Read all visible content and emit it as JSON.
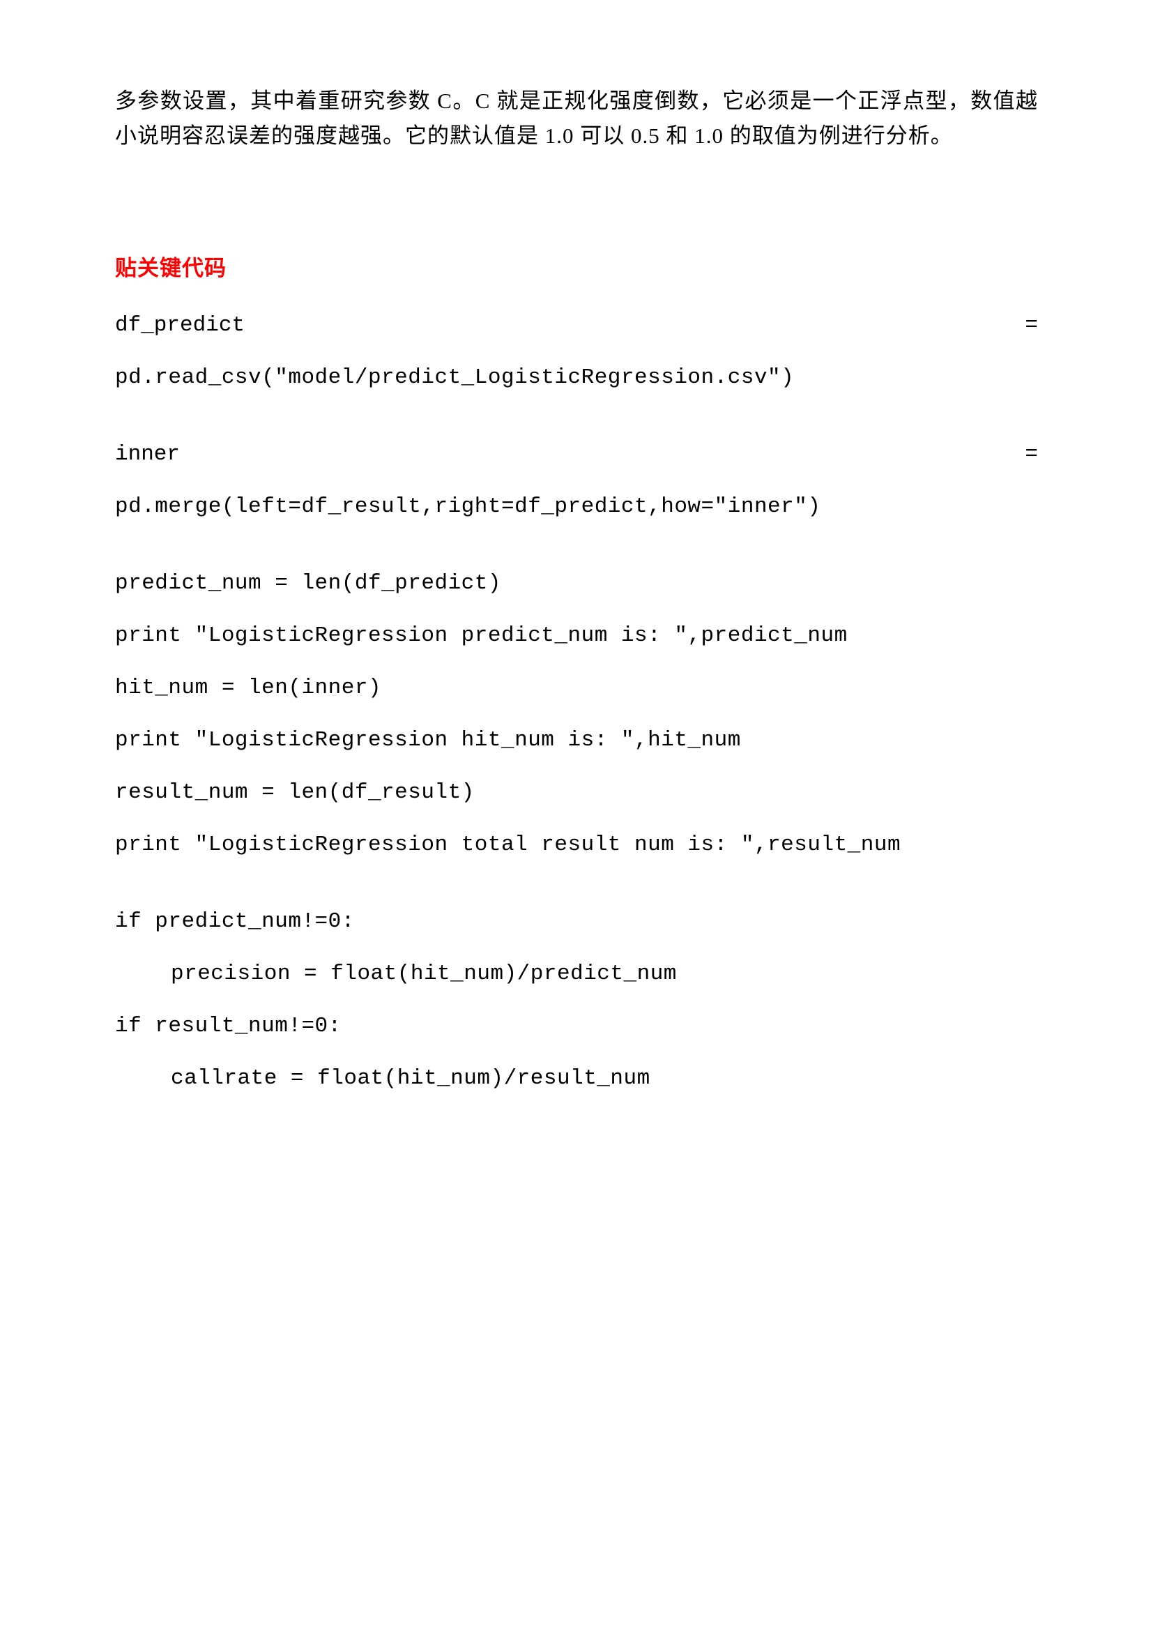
{
  "intro": "多参数设置，其中着重研究参数 C。C 就是正规化强度倒数，它必须是一个正浮点型，数值越小说明容忍误差的强度越强。它的默认值是 1.0 可以 0.5 和 1.0 的取值为例进行分析。",
  "heading": "贴关键代码",
  "code": {
    "line01_left": "df_predict",
    "line01_right": "=",
    "line02": "pd.read_csv(\"model/predict_LogisticRegression.csv\")",
    "line03_left": "inner",
    "line03_right": "=",
    "line04": "pd.merge(left=df_result,right=df_predict,how=\"inner\")",
    "line05": "predict_num = len(df_predict)",
    "line06": "print \"LogisticRegression predict_num is: \",predict_num",
    "line07": "hit_num = len(inner)",
    "line08": "print \"LogisticRegression hit_num is: \",hit_num",
    "line09": "result_num = len(df_result)",
    "line10": "print \"LogisticRegression total result num is: \",result_num",
    "line11": "if predict_num!=0:",
    "line12": "precision = float(hit_num)/predict_num",
    "line13": "if result_num!=0:",
    "line14": "callrate = float(hit_num)/result_num"
  }
}
